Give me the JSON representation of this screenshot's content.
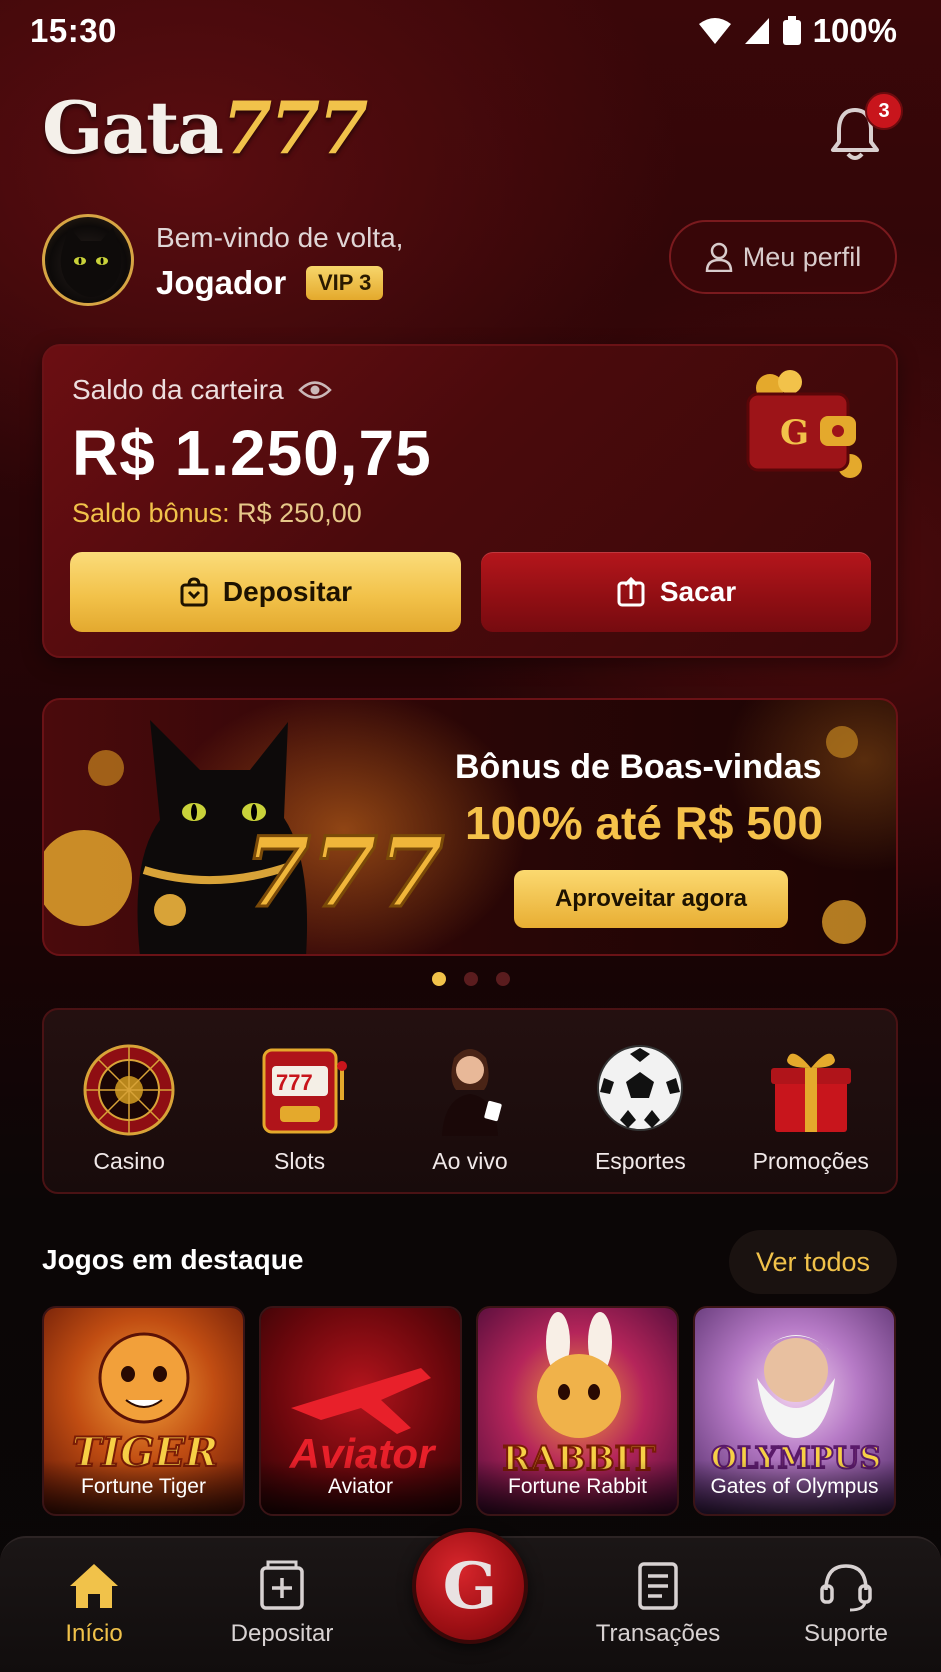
{
  "status_bar": {
    "time": "15:30",
    "battery": "100%"
  },
  "header": {
    "logo_part1": "Gata",
    "logo_part2": "777",
    "notification_count": "3"
  },
  "profile": {
    "welcome": "Bem-vindo de volta,",
    "name": "Jogador",
    "vip": "VIP 3",
    "profile_button": "Meu perfil"
  },
  "wallet": {
    "label": "Saldo da carteira",
    "balance": "R$ 1.250,75",
    "bonus_label": "Saldo bônus:",
    "bonus_value": "R$ 250,00",
    "deposit_button": "Depositar",
    "withdraw_button": "Sacar"
  },
  "banner": {
    "title": "Bônus de Boas-vindas",
    "amount": "100% até R$ 500",
    "cta": "Aproveitar agora",
    "slides": 3,
    "active_slide": 1
  },
  "categories": [
    {
      "label": "Casino",
      "icon": "roulette-icon"
    },
    {
      "label": "Slots",
      "icon": "slot-machine-icon"
    },
    {
      "label": "Ao vivo",
      "icon": "live-dealer-icon"
    },
    {
      "label": "Esportes",
      "icon": "soccer-ball-icon"
    },
    {
      "label": "Promoções",
      "icon": "gift-icon"
    }
  ],
  "featured": {
    "title": "Jogos em destaque",
    "see_all": "Ver todos",
    "games": [
      {
        "name": "Fortune Tiger",
        "art_text": "TIGER"
      },
      {
        "name": "Aviator",
        "art_text": "Aviator"
      },
      {
        "name": "Fortune Rabbit",
        "art_text": "RABBIT"
      },
      {
        "name": "Gates of Olympus",
        "art_text": "OLYMPUS"
      }
    ]
  },
  "bottom_nav": {
    "items": [
      {
        "label": "Início",
        "icon": "home-icon",
        "active": true
      },
      {
        "label": "Depositar",
        "icon": "deposit-icon",
        "active": false
      },
      {
        "label": "Transações",
        "icon": "transactions-icon",
        "active": false
      },
      {
        "label": "Suporte",
        "icon": "support-headset-icon",
        "active": false
      }
    ],
    "center_button": "G"
  },
  "colors": {
    "accent_gold": "#f1c24a",
    "brand_red": "#9d0f14",
    "background": "#0a0606"
  }
}
